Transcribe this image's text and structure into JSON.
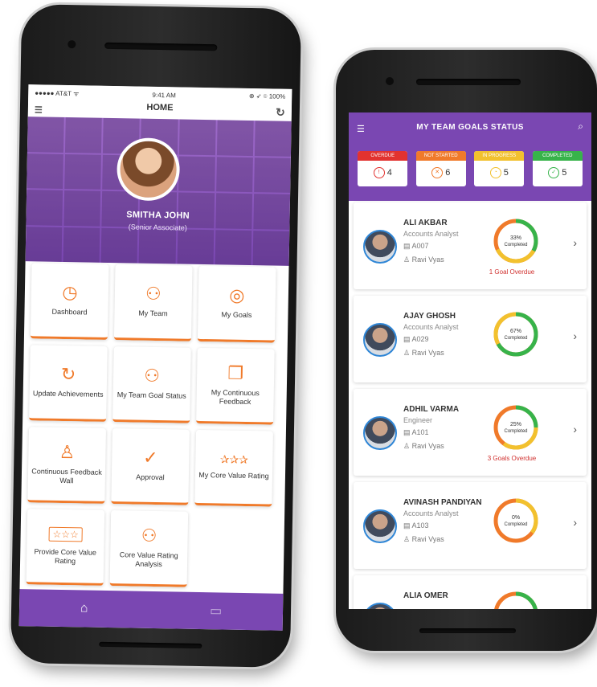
{
  "left_phone": {
    "status_bar": {
      "carrier": "●●●●● AT&T ᯤ",
      "time": "9:41 AM",
      "battery": "⊕ ➶ ⌾ 100%"
    },
    "header": {
      "title": "HOME"
    },
    "profile": {
      "name": "SMITHA JOHN",
      "role": "(Senior Associate)"
    },
    "tiles": [
      {
        "label": "Dashboard",
        "icon": "gauge-icon",
        "glyph": "◷"
      },
      {
        "label": "My Team",
        "icon": "team-icon",
        "glyph": "⚇"
      },
      {
        "label": "My Goals",
        "icon": "target-icon",
        "glyph": "◎"
      },
      {
        "label": "Update Achievements",
        "icon": "timer-icon",
        "glyph": "↻"
      },
      {
        "label": "My Team Goal Status",
        "icon": "team-status-icon",
        "glyph": "⚇"
      },
      {
        "label": "My Continuous Feedback",
        "icon": "chat-icon",
        "glyph": "❐"
      },
      {
        "label": "Continuous Feedback Wall",
        "icon": "person-icon",
        "glyph": "♙"
      },
      {
        "label": "Approval",
        "icon": "check-circle-icon",
        "glyph": "✓"
      },
      {
        "label": "My Core Value Rating",
        "icon": "stars-icon",
        "glyph": "✰✰✰"
      },
      {
        "label": "Provide Core Value Rating",
        "icon": "rating-box-icon",
        "glyph": "☆☆☆"
      },
      {
        "label": "Core Value Rating Analysis",
        "icon": "analysis-icon",
        "glyph": "⚇"
      }
    ],
    "bottom_nav": [
      {
        "name": "home-icon",
        "glyph": "⌂"
      },
      {
        "name": "message-icon",
        "glyph": "▭"
      }
    ]
  },
  "right_phone": {
    "header": {
      "title": "MY TEAM GOALS STATUS"
    },
    "stats": [
      {
        "label": "OVERDUE",
        "value": "4",
        "color": "#e2322f",
        "glyph": "!"
      },
      {
        "label": "NOT STARTED",
        "value": "6",
        "color": "#f07a2a",
        "glyph": "✕"
      },
      {
        "label": "IN PROGRESS",
        "value": "5",
        "color": "#f2c12e",
        "glyph": "◔"
      },
      {
        "label": "COMPLETED",
        "value": "5",
        "color": "#37b34a",
        "glyph": "✓"
      }
    ],
    "members": [
      {
        "name": "ALI AKBAR",
        "designation": "Accounts Analyst",
        "id": "A007",
        "manager": "Ravi Vyas",
        "percent": 33,
        "completed_label": "33%",
        "completed_text": "Completed",
        "overdue": "1 Goal Overdue"
      },
      {
        "name": "AJAY GHOSH",
        "designation": "Accounts Analyst",
        "id": "A029",
        "manager": "Ravi Vyas",
        "percent": 67,
        "completed_label": "67%",
        "completed_text": "Completed",
        "overdue": ""
      },
      {
        "name": "ADHIL VARMA",
        "designation": "Engineer",
        "id": "A101",
        "manager": "Ravi Vyas",
        "percent": 25,
        "completed_label": "25%",
        "completed_text": "Completed",
        "overdue": "3 Goals Overdue"
      },
      {
        "name": "AVINASH PANDIYAN",
        "designation": "Accounts Analyst",
        "id": "A103",
        "manager": "Ravi Vyas",
        "percent": 0,
        "completed_label": "0%",
        "completed_text": "Completed",
        "overdue": ""
      },
      {
        "name": "ALIA OMER",
        "designation": "",
        "id": "",
        "manager": "",
        "percent": 40,
        "completed_label": "",
        "completed_text": "",
        "overdue": ""
      }
    ],
    "ring_colors": {
      "done": "#37b34a",
      "mid": "#f2c12e",
      "rest": "#f07a2a"
    }
  }
}
